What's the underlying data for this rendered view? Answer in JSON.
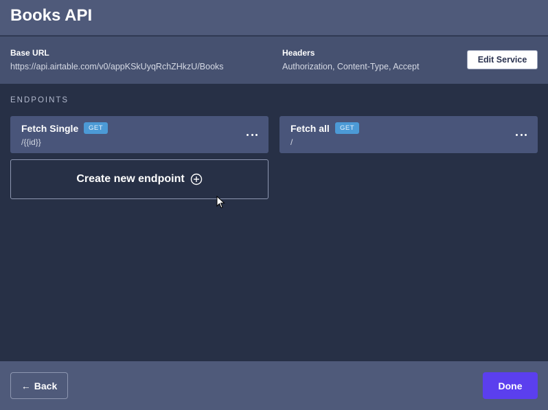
{
  "header": {
    "title": "Books API"
  },
  "service": {
    "base_url_label": "Base URL",
    "base_url": "https://api.airtable.com/v0/appKSkUyqRchZHkzU/Books",
    "headers_label": "Headers",
    "headers": "Authorization, Content-Type, Accept",
    "edit_label": "Edit Service"
  },
  "endpoints": {
    "section_label": "ENDPOINTS",
    "items": [
      {
        "name": "Fetch Single",
        "method": "GET",
        "path": "/{{id}}"
      },
      {
        "name": "Fetch all",
        "method": "GET",
        "path": "/"
      }
    ],
    "create_label": "Create new endpoint"
  },
  "footer": {
    "back_label": "Back",
    "done_label": "Done"
  },
  "colors": {
    "accent": "#5b3fee",
    "badge": "#4c9ad6",
    "background": "#273046"
  },
  "icons": {
    "menu": "ellipsis-icon",
    "create": "plus-circle-icon",
    "back": "arrow-left-icon"
  }
}
